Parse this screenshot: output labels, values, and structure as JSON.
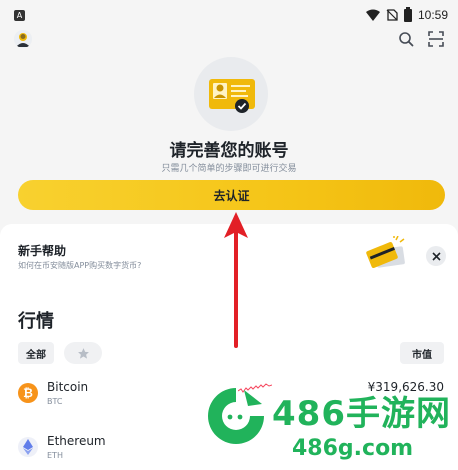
{
  "status_bar": {
    "app_badge": "A",
    "time": "10:59"
  },
  "header": {
    "icons": [
      "avatar",
      "search-icon",
      "scan-icon"
    ]
  },
  "hero": {
    "title": "请完善您的账号",
    "subtitle": "只需几个简单的步骤即可进行交易",
    "button_label": "去认证",
    "accent_color": "#f0b90b"
  },
  "help": {
    "title": "新手帮助",
    "subtitle": "如何在币安随版APP购买数字货币?"
  },
  "market": {
    "title": "行情",
    "tabs": [
      "全部"
    ],
    "sort_label": "市值",
    "coins": [
      {
        "name": "Bitcoin",
        "symbol": "BTC",
        "price": "¥319,626.30",
        "icon_color": "#f7931a",
        "icon_glyph": "₿"
      },
      {
        "name": "Ethereum",
        "symbol": "ETH",
        "price": "",
        "icon_color": "#627eea",
        "icon_glyph": "◆"
      }
    ],
    "sparkline_color": "#f6465d"
  },
  "watermark": {
    "brand": "486手游网",
    "url": "486g.com",
    "color": "#21b35b"
  },
  "annotation": {
    "arrow_color": "#e21f26"
  }
}
